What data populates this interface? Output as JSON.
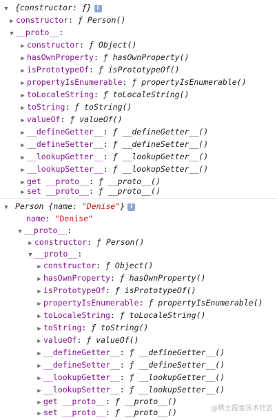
{
  "header1": {
    "text": "{constructor: ƒ}",
    "info": "i"
  },
  "rows1": [
    {
      "tri": "▶",
      "key": "constructor",
      "sig": "Person()"
    },
    {
      "tri": "▼",
      "key": "__proto__",
      "sig": ""
    },
    {
      "tri": "▶",
      "key": "constructor",
      "sig": "Object()"
    },
    {
      "tri": "▶",
      "key": "hasOwnProperty",
      "sig": "hasOwnProperty()"
    },
    {
      "tri": "▶",
      "key": "isPrototypeOf",
      "sig": "isPrototypeOf()"
    },
    {
      "tri": "▶",
      "key": "propertyIsEnumerable",
      "sig": "propertyIsEnumerable()"
    },
    {
      "tri": "▶",
      "key": "toLocaleString",
      "sig": "toLocaleString()"
    },
    {
      "tri": "▶",
      "key": "toString",
      "sig": "toString()"
    },
    {
      "tri": "▶",
      "key": "valueOf",
      "sig": "valueOf()"
    },
    {
      "tri": "▶",
      "key": "__defineGetter__",
      "sig": "__defineGetter__()"
    },
    {
      "tri": "▶",
      "key": "__defineSetter__",
      "sig": "__defineSetter__()"
    },
    {
      "tri": "▶",
      "key": "__lookupGetter__",
      "sig": "__lookupGetter__()"
    },
    {
      "tri": "▶",
      "key": "__lookupSetter__",
      "sig": "__lookupSetter__()"
    },
    {
      "tri": "▶",
      "key": "get __proto__",
      "sig": "__proto__()"
    },
    {
      "tri": "▶",
      "key": "set __proto__",
      "sig": "__proto__()"
    }
  ],
  "header2": {
    "class_name": "Person",
    "open": " {name: ",
    "value": "\"Denise\"",
    "close": "}",
    "info": "i"
  },
  "name_row": {
    "key": "name",
    "value": "\"Denise\""
  },
  "rows2": [
    {
      "tri": "▼",
      "key": "__proto__",
      "sig": ""
    },
    {
      "tri": "▶",
      "key": "constructor",
      "sig": "Person()"
    },
    {
      "tri": "▼",
      "key": "__proto__",
      "sig": ""
    },
    {
      "tri": "▶",
      "key": "constructor",
      "sig": "Object()"
    },
    {
      "tri": "▶",
      "key": "hasOwnProperty",
      "sig": "hasOwnProperty()"
    },
    {
      "tri": "▶",
      "key": "isPrototypeOf",
      "sig": "isPrototypeOf()"
    },
    {
      "tri": "▶",
      "key": "propertyIsEnumerable",
      "sig": "propertyIsEnumerable()"
    },
    {
      "tri": "▶",
      "key": "toLocaleString",
      "sig": "toLocaleString()"
    },
    {
      "tri": "▶",
      "key": "toString",
      "sig": "toString()"
    },
    {
      "tri": "▶",
      "key": "valueOf",
      "sig": "valueOf()"
    },
    {
      "tri": "▶",
      "key": "__defineGetter__",
      "sig": "__defineGetter__()"
    },
    {
      "tri": "▶",
      "key": "__defineSetter__",
      "sig": "__defineSetter__()"
    },
    {
      "tri": "▶",
      "key": "__lookupGetter__",
      "sig": "__lookupGetter__()"
    },
    {
      "tri": "▶",
      "key": "__lookupSetter__",
      "sig": "__lookupSetter__()"
    },
    {
      "tri": "▶",
      "key": "get __proto__",
      "sig": "__proto__()"
    },
    {
      "tri": "▶",
      "key": "set __proto__",
      "sig": "__proto__()"
    }
  ],
  "labels": {
    "f": "ƒ",
    "colon": ": "
  },
  "watermark": "@稀土掘金技术社区"
}
